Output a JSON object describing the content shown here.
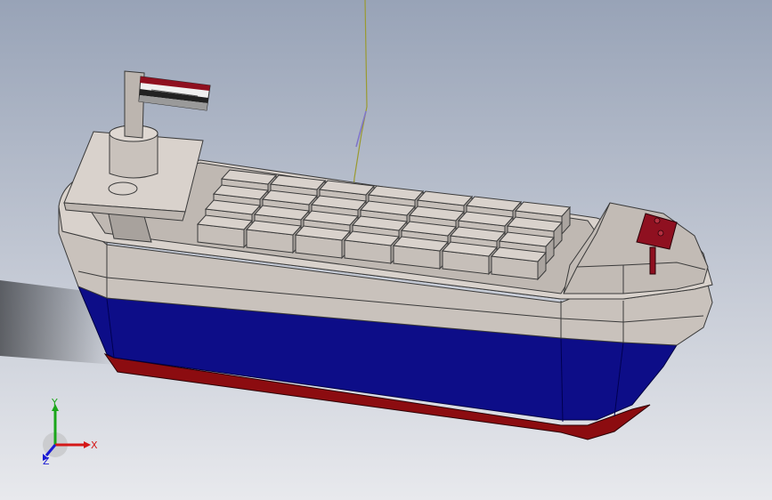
{
  "viewport": {
    "background_top": "#9aa4b8",
    "background_bottom": "#e6e8ec"
  },
  "model": {
    "hull_colors": {
      "deck_grey": "#c8c1bb",
      "hull_blue": "#0d0d88",
      "keel_red": "#8c0c10",
      "flag_red": "#8f1020",
      "dark_stack": "#8f8a86"
    }
  },
  "triad": {
    "x_label": "X",
    "y_label": "Y",
    "z_label": "Z",
    "x_color": "#d41818",
    "y_color": "#1aa61a",
    "z_color": "#1a1ad4"
  }
}
